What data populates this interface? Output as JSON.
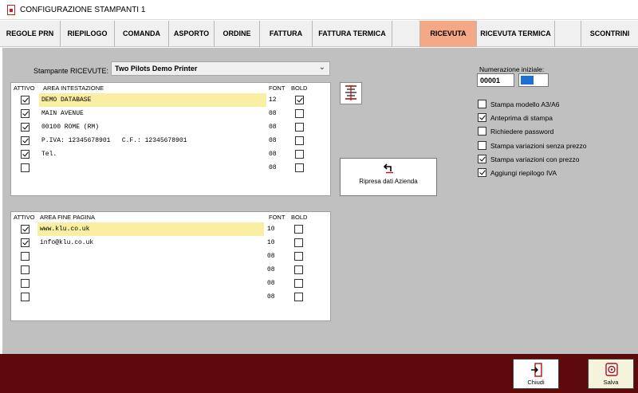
{
  "window": {
    "title": "CONFIGURAZIONE STAMPANTI 1"
  },
  "tabs": [
    {
      "label": "REGOLE PRN",
      "active": false
    },
    {
      "label": "RIEPILOGO",
      "active": false
    },
    {
      "label": "COMANDA",
      "active": false
    },
    {
      "label": "ASPORTO",
      "active": false
    },
    {
      "label": "ORDINE",
      "active": false
    },
    {
      "label": "FATTURA",
      "active": false
    },
    {
      "label": "FATTURA TERMICA",
      "active": false
    },
    {
      "label": "",
      "active": false
    },
    {
      "label": "RICEVUTA",
      "active": true
    },
    {
      "label": "RICEVUTA TERMICA",
      "active": false
    },
    {
      "label": "",
      "active": false
    },
    {
      "label": "SCONTRINI",
      "active": false
    }
  ],
  "printer": {
    "label": "Stampante RICEVUTE:",
    "selected": "Two Pilots Demo Printer"
  },
  "header_area": {
    "columns": {
      "active": "ATTIVO",
      "area": "AREA INTESTAZIONE",
      "font": "FONT",
      "bold": "BOLD"
    },
    "rows": [
      {
        "active": true,
        "text": "DEMO DATABASE",
        "font": "12",
        "bold": true,
        "highlight": true
      },
      {
        "active": true,
        "text": "MAIN AVENUE",
        "font": "08",
        "bold": false,
        "highlight": false
      },
      {
        "active": true,
        "text": "00100 ROME (RM)",
        "font": "08",
        "bold": false,
        "highlight": false
      },
      {
        "active": true,
        "text": "P.IVA: 12345678901   C.F.: 12345678901",
        "font": "08",
        "bold": false,
        "highlight": false
      },
      {
        "active": true,
        "text": "Tel.",
        "font": "08",
        "bold": false,
        "highlight": false
      },
      {
        "active": false,
        "text": "",
        "font": "08",
        "bold": false,
        "highlight": false
      }
    ]
  },
  "footer_area": {
    "columns": {
      "active": "ATTIVO",
      "area": "AREA FINE PAGINA",
      "font": "FONT",
      "bold": "BOLD"
    },
    "rows": [
      {
        "active": true,
        "text": "www.klu.co.uk",
        "font": "10",
        "bold": false,
        "highlight": true
      },
      {
        "active": true,
        "text": "info@klu.co.uk",
        "font": "10",
        "bold": false,
        "highlight": false
      },
      {
        "active": false,
        "text": "",
        "font": "08",
        "bold": false,
        "highlight": false
      },
      {
        "active": false,
        "text": "",
        "font": "08",
        "bold": false,
        "highlight": false
      },
      {
        "active": false,
        "text": "",
        "font": "08",
        "bold": false,
        "highlight": false
      },
      {
        "active": false,
        "text": "",
        "font": "08",
        "bold": false,
        "highlight": false
      }
    ]
  },
  "ripresa_button": {
    "label": "Ripresa dati Azienda",
    "icon": "undo-arrow-icon"
  },
  "align_button": {
    "icon": "align-lines-icon"
  },
  "numerazione": {
    "label": "Numerazione iniziale:",
    "value": "00001"
  },
  "options": [
    {
      "label": "Stampa modello A3/A6",
      "checked": false
    },
    {
      "label": "Anteprima di stampa",
      "checked": true
    },
    {
      "label": "Richiedere password",
      "checked": false
    },
    {
      "label": "Stampa variazioni senza prezzo",
      "checked": false
    },
    {
      "label": "Stampa variazioni con prezzo",
      "checked": true
    },
    {
      "label": "Aggiungi riepilogo IVA",
      "checked": true
    }
  ],
  "footer_buttons": {
    "close": {
      "label": "Chiudi",
      "icon": "exit-door-icon"
    },
    "save": {
      "label": "Salva",
      "icon": "save-icon"
    }
  },
  "colors": {
    "active_tab": "#f4a886",
    "bottom_bar": "#5e0a0a",
    "highlight_row": "#faeea3",
    "toggle_accent": "#1e70d2"
  }
}
